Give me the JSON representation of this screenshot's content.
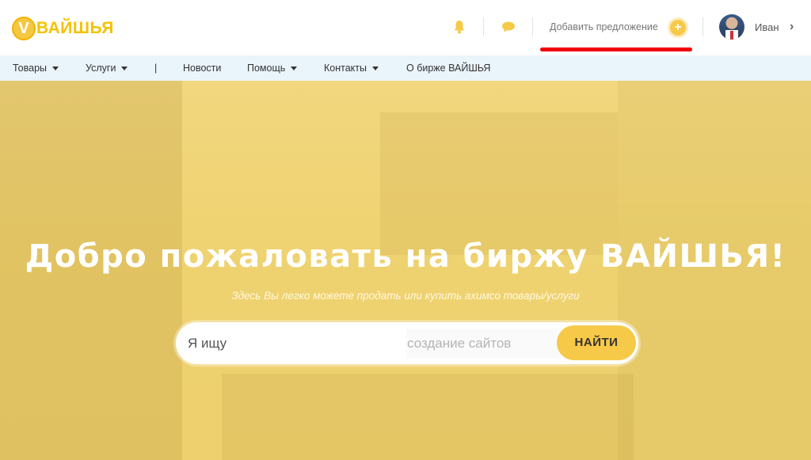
{
  "header": {
    "logo_letter": "V",
    "logo_text": "ВАЙШЬЯ",
    "add_offer_label": "Добавить предложение",
    "plus_symbol": "+",
    "user_name": "Иван",
    "chevron": "›",
    "icons": [
      "bell-icon",
      "chat-icon",
      "plus-icon",
      "chevron-right-icon"
    ]
  },
  "nav": {
    "items": [
      {
        "label": "Товары",
        "dropdown": true
      },
      {
        "label": "Услуги",
        "dropdown": true
      },
      {
        "label": "|",
        "dropdown": false
      },
      {
        "label": "Новости",
        "dropdown": false
      },
      {
        "label": "Помощь",
        "dropdown": true
      },
      {
        "label": "Контакты",
        "dropdown": true
      },
      {
        "label": "О бирже ВАЙШЬЯ",
        "dropdown": false
      }
    ]
  },
  "hero": {
    "title": "Добро пожаловать на биржу ВАЙШЬЯ!",
    "subtitle": "Здесь Вы легко можете продать или купить ахимсо товары/услуги",
    "search_prefix": "Я ищу",
    "search_placeholder": "создание сайтов",
    "search_value": "",
    "search_button": "НАЙТИ"
  },
  "colors": {
    "accent": "#f7c948",
    "logo": "#f5c200",
    "nav_bg": "#eaf4fb",
    "hero_tint": "#efd271",
    "annotation_red": "#f10000"
  }
}
